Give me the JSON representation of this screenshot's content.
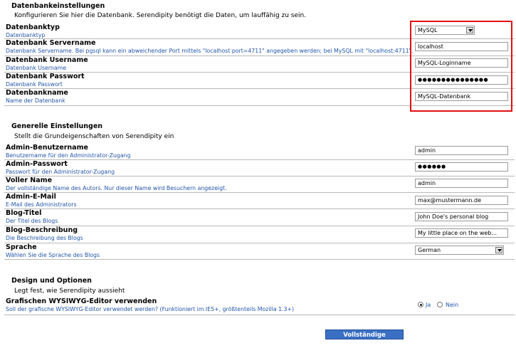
{
  "database": {
    "title": "Datenbankeinstellungen",
    "description": "Konfigurieren Sie hier die Datenbank. Serendipity benötigt die Daten, um lauffähig zu sein.",
    "fields": [
      {
        "label": "Datenbanktyp",
        "sub": "Datenbanktyp",
        "value": "MySQL"
      },
      {
        "label": "Datenbank Servername",
        "sub": "Datenbank Servername. Bei pgsql kann ein abweichender Port mittels \"localhost port=4711\" angegeben werden; bei MySQL mit \"localhost:4711\".",
        "value": "localhost"
      },
      {
        "label": "Datenbank Username",
        "sub": "Datenbank Username",
        "value": "MySQL-Loginname"
      },
      {
        "label": "Datenbank Passwort",
        "sub": "Datenbank Passwort",
        "value": "●●●●●●●●●●●●●●●"
      },
      {
        "label": "Datenbankname",
        "sub": "Name der Datenbank",
        "value": "MySQL-Datenbank"
      }
    ]
  },
  "general": {
    "title": "Generelle Einstellungen",
    "description": "Stellt die Grundeigenschaften von Serendipity ein",
    "fields": [
      {
        "label": "Admin-Benutzername",
        "sub": "Benutzername für den Administrator-Zugang",
        "value": "admin"
      },
      {
        "label": "Admin-Passwort",
        "sub": "Passwort für den Administrator-Zugang",
        "value": "●●●●●●"
      },
      {
        "label": "Voller Name",
        "sub": "Der vollständige Name des Autors. Nur dieser Name wird Besuchern angezeigt.",
        "value": "admin"
      },
      {
        "label": "Admin-E-Mail",
        "sub": "E-Mail des Administrators",
        "value": "max@mustermann.de"
      },
      {
        "label": "Blog-Titel",
        "sub": "Der Titel des Blogs",
        "value": "John Doe's personal blog"
      },
      {
        "label": "Blog-Beschreibung",
        "sub": "Die Beschreibung des Blogs",
        "value": "My little place on the web..."
      },
      {
        "label": "Sprache",
        "sub": "Wählen Sie die Sprache des Blogs",
        "value": "German"
      }
    ]
  },
  "design": {
    "title": "Design und Optionen",
    "description": "Legt fest, wie Serendipity aussieht",
    "wysiwyg": {
      "label": "Grafischen WYSIWYG-Editor verwenden",
      "sub": "Soll der grafische WYSIWYG-Editor verwendet werden? (Funktioniert im IE5+, größtenteils Mozilla 1.3+)",
      "yes": "Ja",
      "no": "Nein"
    }
  },
  "submit_label": "Vollständige Installation",
  "colors": {
    "highlight": "#e01010",
    "link": "#2255aa",
    "button": "#3a6fc4"
  }
}
